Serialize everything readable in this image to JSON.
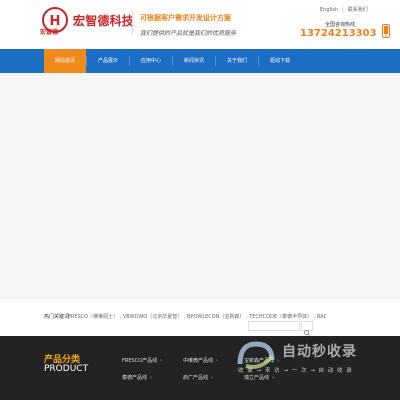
{
  "header": {
    "logo_small": "宏智德",
    "logo_name": "宏智德科技",
    "slogan_primary": "可根据客户需求开发设计方案",
    "slogan_secondary": "我们提供的产品就是我们的优质服务",
    "top_links": {
      "english": "English",
      "divider": "|",
      "contact": "联系我们"
    },
    "hotline_label": "全国咨询热线",
    "hotline_number": "13724213303"
  },
  "nav": {
    "items": [
      {
        "label": "网站首页",
        "active": true
      },
      {
        "label": "产品展示",
        "active": false
      },
      {
        "label": "应用中心",
        "active": false
      },
      {
        "label": "新闻资讯",
        "active": false
      },
      {
        "label": "关于我们",
        "active": false
      },
      {
        "label": "驱动下载",
        "active": false
      }
    ]
  },
  "hot_search": {
    "label": "热门关键词：",
    "keywords": "FRESCO（佛莱硕士） , VBWDWO（北京华夏智） , BPOWLECON（宝新森） , TECHCODE（泰德半导体） , RADAUX（台湾瑞立） , 等",
    "search_placeholder": ""
  },
  "categories": {
    "title_cn": "产品分类",
    "title_en": "PRODUCT",
    "items": [
      {
        "label": "FRESCO产品线",
        "arrow": "›"
      },
      {
        "label": "中维微产品线",
        "arrow": "›"
      },
      {
        "label": "宝新森产品线",
        "arrow": "›"
      },
      {
        "label": "泰德产品线",
        "arrow": "›"
      },
      {
        "label": "启广产品线",
        "arrow": "›"
      },
      {
        "label": "瑞立产品线",
        "arrow": "›"
      }
    ]
  },
  "watermark": {
    "title": "自动秒收录",
    "subtitle": "收 录 → 来 访 → 一 次 → 自 动 收 录"
  },
  "colors": {
    "brand_red": "#c8262b",
    "accent_orange": "#f08a1d",
    "nav_blue": "#1c6ec4",
    "footer_dark": "#232323"
  }
}
